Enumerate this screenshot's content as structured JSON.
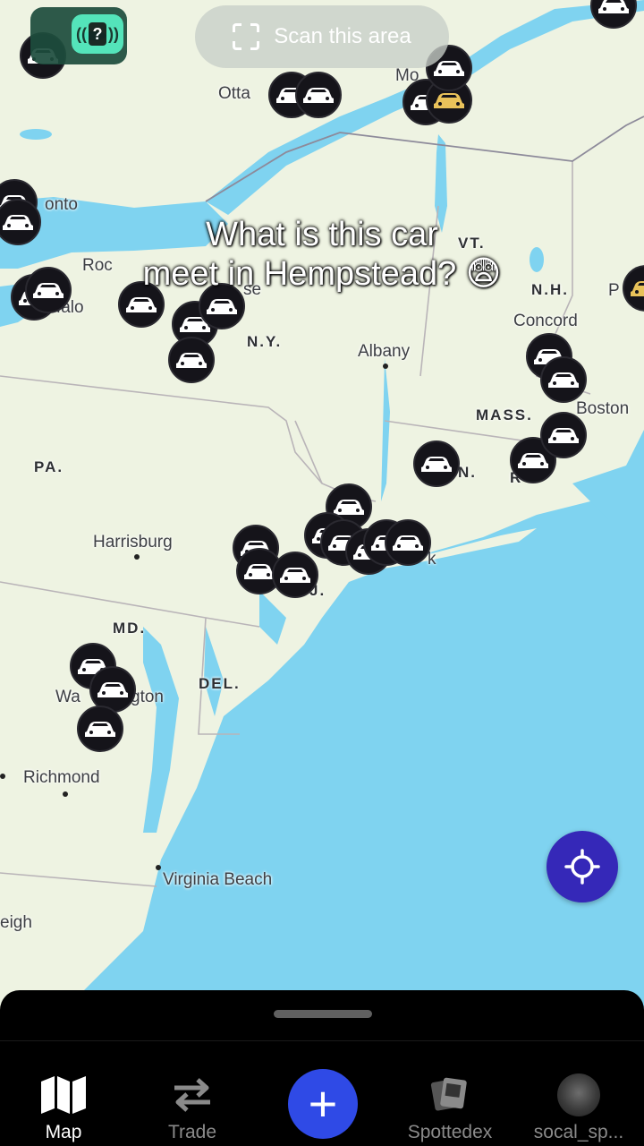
{
  "map": {
    "labels": {
      "ottawa": "Otta",
      "montreal": "Mo",
      "toronto": "onto",
      "rochester": "Roc",
      "buffalo": "ffalo",
      "syracuse": "se",
      "ny_state": "N.Y.",
      "vt": "VT.",
      "nh": "N.H.",
      "concord": "Concord",
      "albany": "Albany",
      "mass": "MASS.",
      "boston": "Boston",
      "ct": "N.",
      "ri": "R",
      "pa": "PA.",
      "harrisburg": "Harrisburg",
      "nyc": "k",
      "nj": "J.",
      "md": "MD.",
      "del": "DEL.",
      "washington_a": "Wa",
      "washington_b": "gton",
      "richmond": "Richmond",
      "virginia_beach": "Virginia Beach",
      "raleigh": "eigh",
      "portland": "P"
    }
  },
  "top_bar": {
    "nfc_badge": "?",
    "scan_label": "Scan this area"
  },
  "caption": {
    "line1": "What is this car",
    "line2": "meet in Hempstead? 😨"
  },
  "tabs": {
    "map": "Map",
    "trade": "Trade",
    "add": "+",
    "spottedex": "Spottedex",
    "profile": "socal_sp..."
  },
  "colors": {
    "land": "#eef3e2",
    "water": "#7fd3f0",
    "pin": "#15141a",
    "accent": "#3528b8",
    "add_button": "#2f4ae6"
  }
}
